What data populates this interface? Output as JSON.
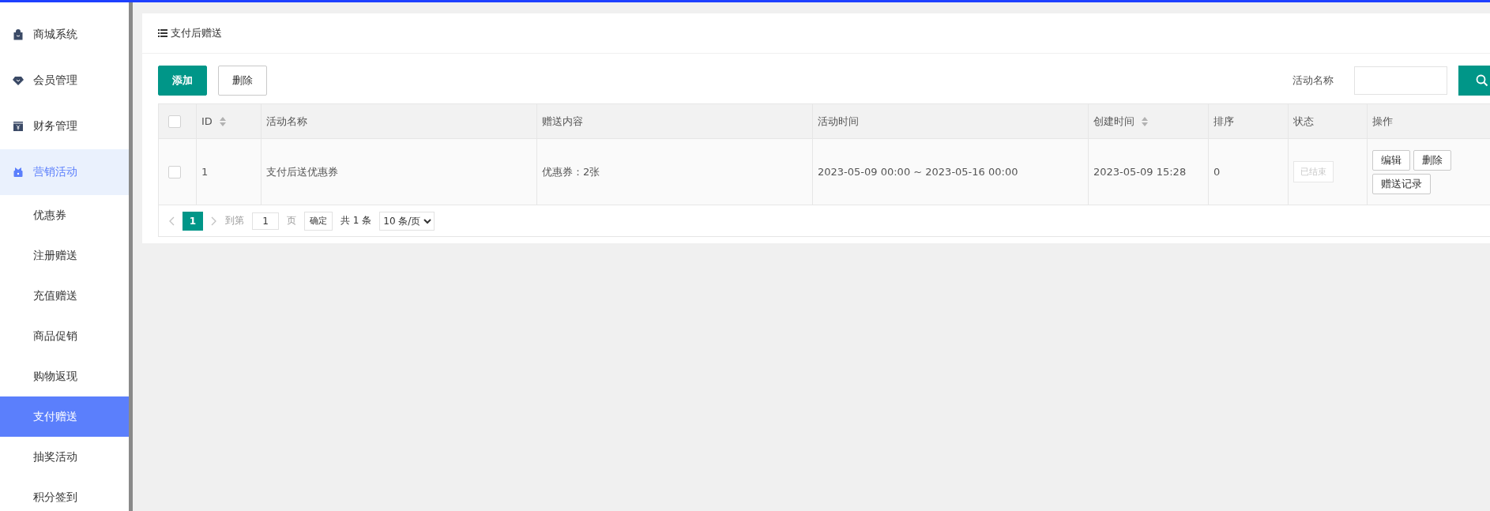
{
  "sidebar": {
    "items": [
      {
        "label": "商城系统",
        "kind": "bag",
        "selected": false
      },
      {
        "label": "会员管理",
        "kind": "diamond",
        "selected": false
      },
      {
        "label": "财务管理",
        "kind": "yuan",
        "selected": false
      },
      {
        "label": "营销活动",
        "kind": "gift",
        "selected": true,
        "children": [
          {
            "label": "优惠券",
            "selected": false
          },
          {
            "label": "注册赠送",
            "selected": false
          },
          {
            "label": "充值赠送",
            "selected": false
          },
          {
            "label": "商品促销",
            "selected": false
          },
          {
            "label": "购物返现",
            "selected": false
          },
          {
            "label": "支付赠送",
            "selected": true
          },
          {
            "label": "抽奖活动",
            "selected": false
          },
          {
            "label": "积分签到",
            "selected": false
          }
        ]
      }
    ]
  },
  "page": {
    "title": "支付后赠送"
  },
  "toolbar": {
    "buttons": [
      {
        "label": "添加",
        "kind": "primary"
      },
      {
        "label": "删除",
        "kind": "default"
      }
    ],
    "search": {
      "label": "活动名称"
    }
  },
  "table": {
    "header_checkbox": {
      "checked": false
    },
    "columns": [
      {
        "label": "ID",
        "sortable": true
      },
      {
        "label": "活动名称",
        "sortable": false
      },
      {
        "label": "赠送内容",
        "sortable": false
      },
      {
        "label": "活动时间",
        "sortable": false
      },
      {
        "label": "创建时间",
        "sortable": true
      },
      {
        "label": "排序",
        "sortable": false
      },
      {
        "label": "状态",
        "sortable": false
      },
      {
        "label": "操作",
        "sortable": false
      }
    ],
    "rows": [
      {
        "checked": false,
        "id": "1",
        "name": "支付后送优惠券",
        "content": "优惠券：2张",
        "time": "2023-05-09 00:00 ~ 2023-05-16 00:00",
        "created": "2023-05-09 15:28",
        "order": "0",
        "status": {
          "label": "已结束",
          "disabled": true
        },
        "actions": [
          "编辑",
          "删除",
          "赠送记录"
        ]
      }
    ]
  },
  "pagination": {
    "pages": [
      {
        "label": "1",
        "selected": true
      }
    ],
    "goto_label": "到第",
    "goto_value": "1",
    "page_unit": "页",
    "confirm": "确定",
    "total": "共 1 条",
    "page_size": "10 条/页"
  }
}
